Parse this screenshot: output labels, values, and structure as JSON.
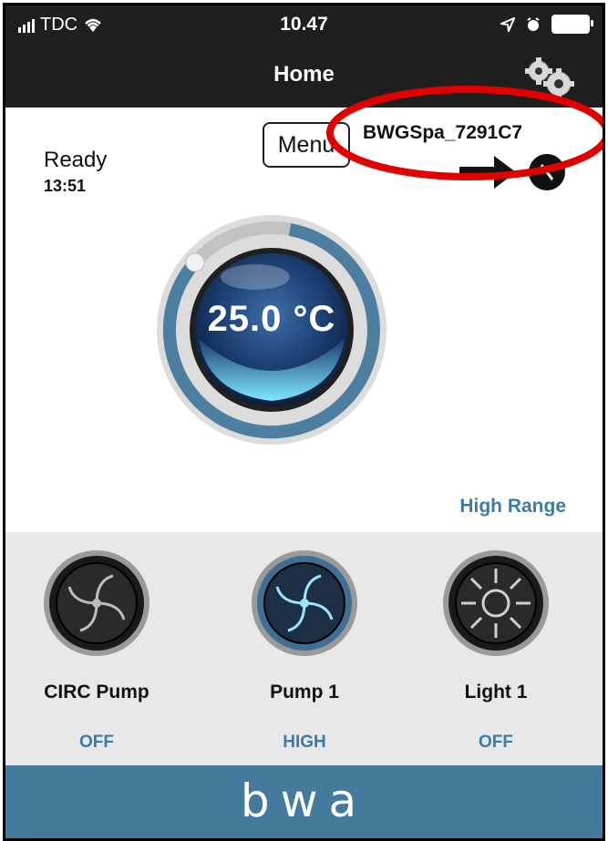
{
  "status_bar": {
    "carrier": "TDC",
    "time": "10.47"
  },
  "nav": {
    "title": "Home",
    "settings_icon": "gears-icon"
  },
  "spa": {
    "status": "Ready",
    "time": "13:51",
    "device_name": "BWGSpa_7291C7",
    "menu_label": "Menu",
    "temperature": "25.0 °C",
    "range": "High Range"
  },
  "controls": [
    {
      "label": "CIRC Pump",
      "state": "OFF"
    },
    {
      "label": "Pump 1",
      "state": "HIGH"
    },
    {
      "label": "Light 1",
      "state": "OFF"
    }
  ],
  "footer": {
    "logo": "bwa"
  },
  "colors": {
    "accent": "#3a7ca5",
    "footer": "#447a9b",
    "header": "#1f1f1f",
    "highlight": "#e00000"
  }
}
